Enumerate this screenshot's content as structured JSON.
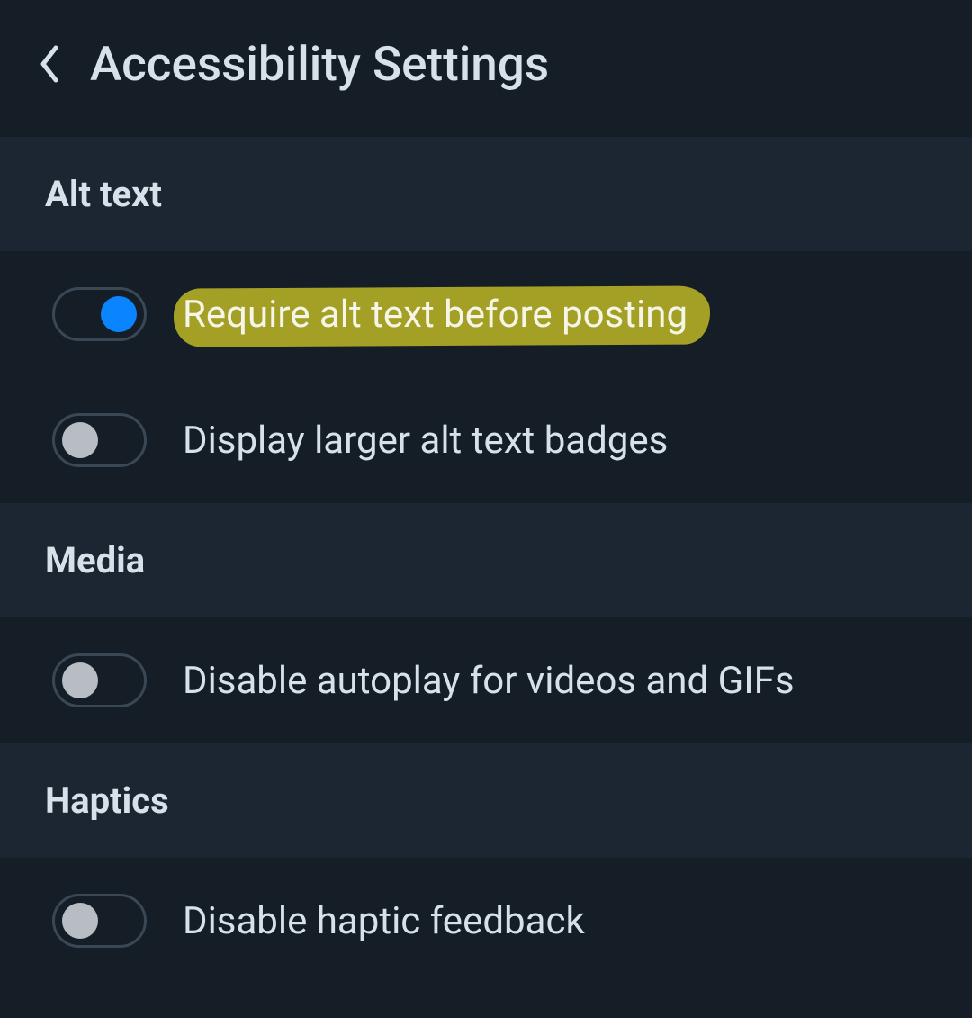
{
  "header": {
    "title": "Accessibility Settings"
  },
  "sections": {
    "altText": {
      "title": "Alt text",
      "items": {
        "requireAlt": {
          "label": "Require alt text before posting",
          "on": true,
          "highlighted": true
        },
        "largerBadges": {
          "label": "Display larger alt text badges",
          "on": false
        }
      }
    },
    "media": {
      "title": "Media",
      "items": {
        "disableAutoplay": {
          "label": "Disable autoplay for videos and GIFs",
          "on": false
        }
      }
    },
    "haptics": {
      "title": "Haptics",
      "items": {
        "disableHaptic": {
          "label": "Disable haptic feedback",
          "on": false
        }
      }
    }
  }
}
